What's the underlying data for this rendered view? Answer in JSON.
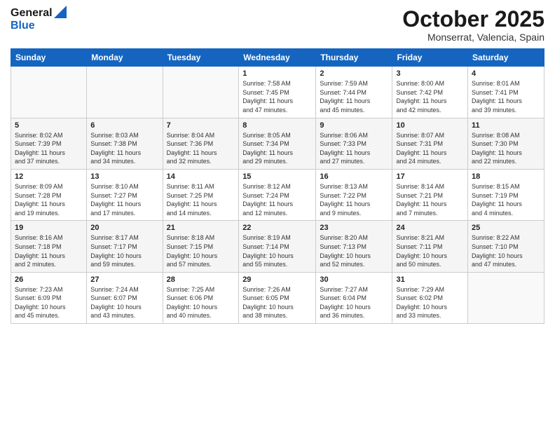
{
  "logo": {
    "general": "General",
    "blue": "Blue"
  },
  "header": {
    "month": "October 2025",
    "location": "Monserrat, Valencia, Spain"
  },
  "weekdays": [
    "Sunday",
    "Monday",
    "Tuesday",
    "Wednesday",
    "Thursday",
    "Friday",
    "Saturday"
  ],
  "weeks": [
    [
      {
        "day": "",
        "info": ""
      },
      {
        "day": "",
        "info": ""
      },
      {
        "day": "",
        "info": ""
      },
      {
        "day": "1",
        "info": "Sunrise: 7:58 AM\nSunset: 7:45 PM\nDaylight: 11 hours\nand 47 minutes."
      },
      {
        "day": "2",
        "info": "Sunrise: 7:59 AM\nSunset: 7:44 PM\nDaylight: 11 hours\nand 45 minutes."
      },
      {
        "day": "3",
        "info": "Sunrise: 8:00 AM\nSunset: 7:42 PM\nDaylight: 11 hours\nand 42 minutes."
      },
      {
        "day": "4",
        "info": "Sunrise: 8:01 AM\nSunset: 7:41 PM\nDaylight: 11 hours\nand 39 minutes."
      }
    ],
    [
      {
        "day": "5",
        "info": "Sunrise: 8:02 AM\nSunset: 7:39 PM\nDaylight: 11 hours\nand 37 minutes."
      },
      {
        "day": "6",
        "info": "Sunrise: 8:03 AM\nSunset: 7:38 PM\nDaylight: 11 hours\nand 34 minutes."
      },
      {
        "day": "7",
        "info": "Sunrise: 8:04 AM\nSunset: 7:36 PM\nDaylight: 11 hours\nand 32 minutes."
      },
      {
        "day": "8",
        "info": "Sunrise: 8:05 AM\nSunset: 7:34 PM\nDaylight: 11 hours\nand 29 minutes."
      },
      {
        "day": "9",
        "info": "Sunrise: 8:06 AM\nSunset: 7:33 PM\nDaylight: 11 hours\nand 27 minutes."
      },
      {
        "day": "10",
        "info": "Sunrise: 8:07 AM\nSunset: 7:31 PM\nDaylight: 11 hours\nand 24 minutes."
      },
      {
        "day": "11",
        "info": "Sunrise: 8:08 AM\nSunset: 7:30 PM\nDaylight: 11 hours\nand 22 minutes."
      }
    ],
    [
      {
        "day": "12",
        "info": "Sunrise: 8:09 AM\nSunset: 7:28 PM\nDaylight: 11 hours\nand 19 minutes."
      },
      {
        "day": "13",
        "info": "Sunrise: 8:10 AM\nSunset: 7:27 PM\nDaylight: 11 hours\nand 17 minutes."
      },
      {
        "day": "14",
        "info": "Sunrise: 8:11 AM\nSunset: 7:25 PM\nDaylight: 11 hours\nand 14 minutes."
      },
      {
        "day": "15",
        "info": "Sunrise: 8:12 AM\nSunset: 7:24 PM\nDaylight: 11 hours\nand 12 minutes."
      },
      {
        "day": "16",
        "info": "Sunrise: 8:13 AM\nSunset: 7:22 PM\nDaylight: 11 hours\nand 9 minutes."
      },
      {
        "day": "17",
        "info": "Sunrise: 8:14 AM\nSunset: 7:21 PM\nDaylight: 11 hours\nand 7 minutes."
      },
      {
        "day": "18",
        "info": "Sunrise: 8:15 AM\nSunset: 7:19 PM\nDaylight: 11 hours\nand 4 minutes."
      }
    ],
    [
      {
        "day": "19",
        "info": "Sunrise: 8:16 AM\nSunset: 7:18 PM\nDaylight: 11 hours\nand 2 minutes."
      },
      {
        "day": "20",
        "info": "Sunrise: 8:17 AM\nSunset: 7:17 PM\nDaylight: 10 hours\nand 59 minutes."
      },
      {
        "day": "21",
        "info": "Sunrise: 8:18 AM\nSunset: 7:15 PM\nDaylight: 10 hours\nand 57 minutes."
      },
      {
        "day": "22",
        "info": "Sunrise: 8:19 AM\nSunset: 7:14 PM\nDaylight: 10 hours\nand 55 minutes."
      },
      {
        "day": "23",
        "info": "Sunrise: 8:20 AM\nSunset: 7:13 PM\nDaylight: 10 hours\nand 52 minutes."
      },
      {
        "day": "24",
        "info": "Sunrise: 8:21 AM\nSunset: 7:11 PM\nDaylight: 10 hours\nand 50 minutes."
      },
      {
        "day": "25",
        "info": "Sunrise: 8:22 AM\nSunset: 7:10 PM\nDaylight: 10 hours\nand 47 minutes."
      }
    ],
    [
      {
        "day": "26",
        "info": "Sunrise: 7:23 AM\nSunset: 6:09 PM\nDaylight: 10 hours\nand 45 minutes."
      },
      {
        "day": "27",
        "info": "Sunrise: 7:24 AM\nSunset: 6:07 PM\nDaylight: 10 hours\nand 43 minutes."
      },
      {
        "day": "28",
        "info": "Sunrise: 7:25 AM\nSunset: 6:06 PM\nDaylight: 10 hours\nand 40 minutes."
      },
      {
        "day": "29",
        "info": "Sunrise: 7:26 AM\nSunset: 6:05 PM\nDaylight: 10 hours\nand 38 minutes."
      },
      {
        "day": "30",
        "info": "Sunrise: 7:27 AM\nSunset: 6:04 PM\nDaylight: 10 hours\nand 36 minutes."
      },
      {
        "day": "31",
        "info": "Sunrise: 7:29 AM\nSunset: 6:02 PM\nDaylight: 10 hours\nand 33 minutes."
      },
      {
        "day": "",
        "info": ""
      }
    ]
  ]
}
